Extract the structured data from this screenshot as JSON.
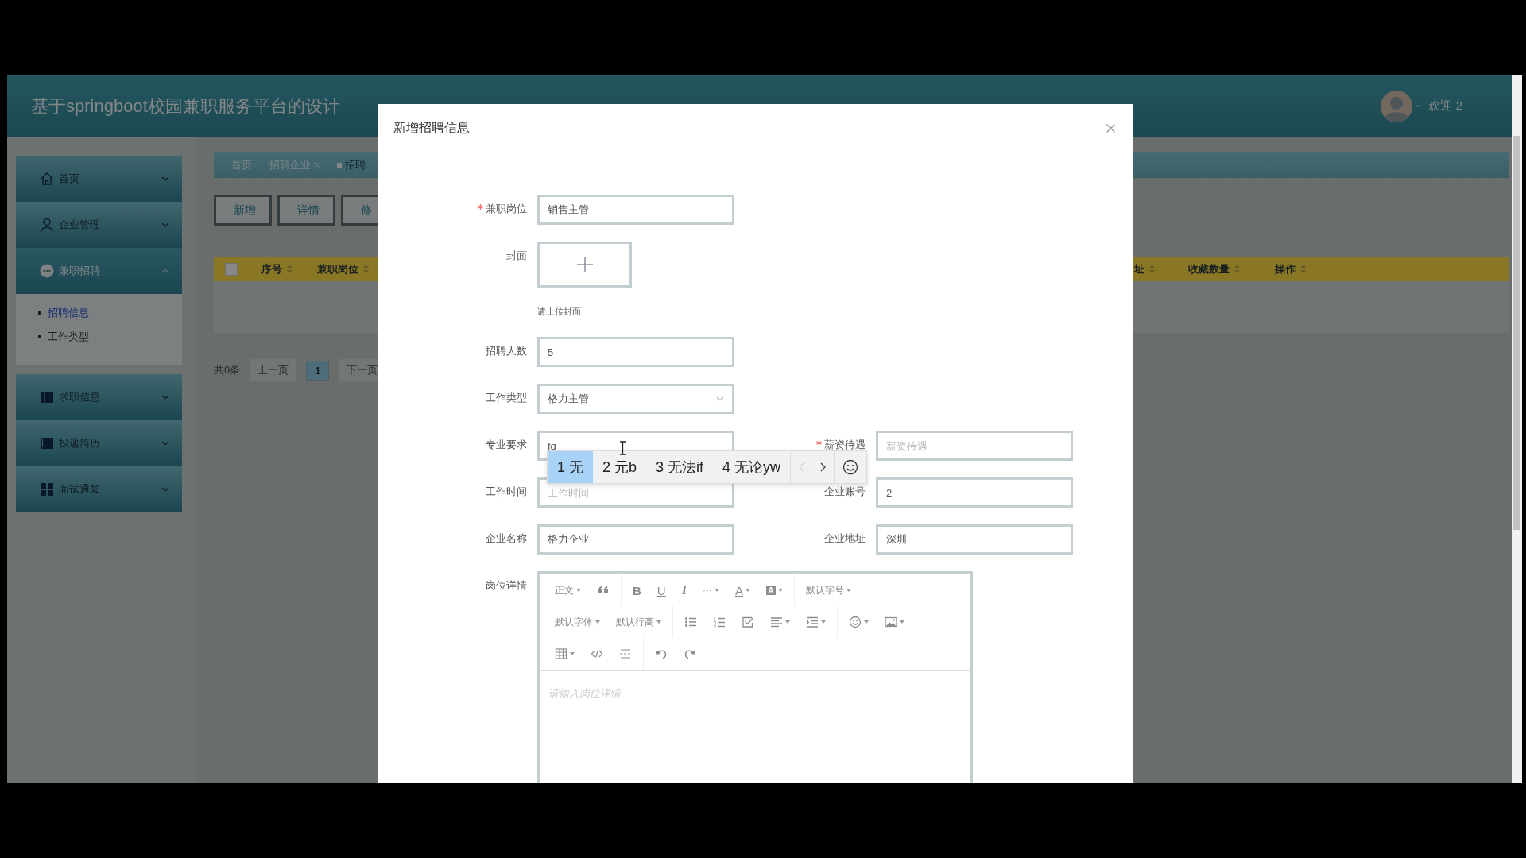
{
  "header": {
    "title": "基于springboot校园兼职服务平台的设计",
    "greeting": "欢迎 2"
  },
  "sidebar": [
    {
      "kind": "home",
      "label": "首页",
      "expanded": false
    },
    {
      "kind": "user",
      "label": "企业管理",
      "expanded": false
    },
    {
      "kind": "chat",
      "label": "兼职招聘",
      "expanded": true,
      "children": [
        {
          "label": "招聘信息",
          "selected": true
        },
        {
          "label": "工作类型",
          "selected": false
        }
      ]
    },
    {
      "kind": "book",
      "label": "求职信息",
      "expanded": false
    },
    {
      "kind": "file",
      "label": "投递简历",
      "expanded": false
    },
    {
      "kind": "grid",
      "label": "面试通知",
      "expanded": false
    }
  ],
  "tabs": [
    {
      "label": "首页",
      "closable": false,
      "selected": false
    },
    {
      "label": "招聘企业",
      "closable": true,
      "selected": false
    },
    {
      "label": "招聘",
      "closable": false,
      "selected": true
    }
  ],
  "actions": [
    "新增",
    "详情",
    "修"
  ],
  "table": {
    "select_all": {
      "checked": false
    },
    "columns": [
      "序号",
      "兼职岗位",
      "址",
      "收藏数量",
      "操作"
    ]
  },
  "pagination": {
    "total": "共0条",
    "prev": "上一页",
    "pages": [
      {
        "label": "1",
        "selected": true
      }
    ],
    "next": "下一页"
  },
  "dialog": {
    "title": "新增招聘信息",
    "rows": [
      [
        {
          "kind": "input",
          "label": "兼职岗位",
          "required": true,
          "value": "销售主管"
        }
      ],
      [
        {
          "kind": "upload",
          "label": "封面",
          "required": false,
          "hint": "请上传封面"
        }
      ],
      [
        {
          "kind": "input",
          "label": "招聘人数",
          "required": false,
          "value": "5"
        }
      ],
      [
        {
          "kind": "select",
          "label": "工作类型",
          "required": false,
          "value": "格力主管"
        }
      ],
      [
        {
          "kind": "input",
          "label": "专业要求",
          "required": false,
          "value": "fq"
        },
        {
          "kind": "input",
          "label": "薪资待遇",
          "required": true,
          "placeholder": "薪资待遇"
        }
      ],
      [
        {
          "kind": "input",
          "label": "工作时间",
          "required": false,
          "placeholder": "工作时间"
        },
        {
          "kind": "input",
          "label": "企业账号",
          "required": false,
          "value": "2"
        }
      ],
      [
        {
          "kind": "input",
          "label": "企业名称",
          "required": false,
          "value": "格力企业"
        },
        {
          "kind": "input",
          "label": "企业地址",
          "required": false,
          "value": "深圳"
        }
      ],
      [
        {
          "kind": "editor",
          "label": "岗位详情",
          "required": false,
          "placeholder": "请输入岗位详情",
          "toolbar": [
            [
              [
                {
                  "kind": "dropdown",
                  "label": "正文"
                },
                {
                  "kind": "quote"
                }
              ],
              [
                {
                  "kind": "bold",
                  "label": "B"
                },
                {
                  "kind": "underline",
                  "label": "U"
                },
                {
                  "kind": "italic",
                  "label": "I"
                },
                {
                  "kind": "more",
                  "label": "···"
                },
                {
                  "kind": "color",
                  "label": "A"
                },
                {
                  "kind": "highlight",
                  "label": "A"
                }
              ],
              [
                {
                  "kind": "dropdown",
                  "label": "默认字号"
                }
              ]
            ],
            [
              [
                {
                  "kind": "dropdown",
                  "label": "默认字体"
                },
                {
                  "kind": "dropdown",
                  "label": "默认行高"
                }
              ],
              [
                {
                  "kind": "bullets"
                },
                {
                  "kind": "numbers"
                },
                {
                  "kind": "todo"
                },
                {
                  "kind": "align"
                },
                {
                  "kind": "indent"
                }
              ],
              [
                {
                  "kind": "emoji"
                },
                {
                  "kind": "image"
                }
              ]
            ],
            [
              [
                {
                  "kind": "table"
                },
                {
                  "kind": "code"
                },
                {
                  "kind": "rule"
                }
              ],
              [
                {
                  "kind": "undo"
                },
                {
                  "kind": "redo"
                }
              ]
            ]
          ]
        }
      ]
    ],
    "ime": {
      "candidates": [
        {
          "label": "1 无",
          "selected": true
        },
        {
          "label": "2 元b",
          "selected": false
        },
        {
          "label": "3 无法if",
          "selected": false
        },
        {
          "label": "4 无论yw",
          "selected": false
        }
      ],
      "prev_disabled": true,
      "next_disabled": false
    }
  }
}
